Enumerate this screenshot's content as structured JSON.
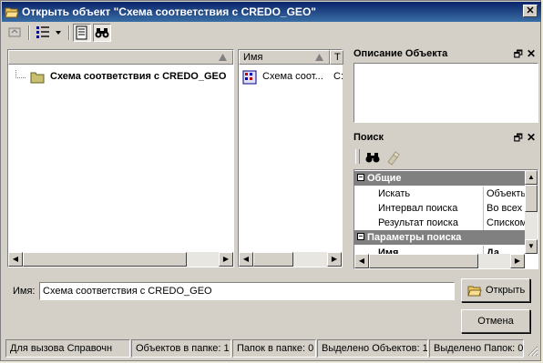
{
  "window": {
    "title": "Открыть объект \"Схема соответствия с CREDO_GEO\"",
    "close_glyph": "✕"
  },
  "tree": {
    "items": [
      {
        "label": "Схема соответствия с CREDO_GEO"
      }
    ]
  },
  "list": {
    "columns": [
      "Имя",
      "Т"
    ],
    "rows": [
      {
        "name": "Схема соот...",
        "type": "С:"
      }
    ]
  },
  "description_panel": {
    "title": "Описание Объекта"
  },
  "search_panel": {
    "title": "Поиск",
    "categories": [
      {
        "name": "Общие",
        "props": [
          {
            "name": "Искать",
            "value": "Объекты"
          },
          {
            "name": "Интервал поиска",
            "value": "Во всех п"
          },
          {
            "name": "Результат поиска",
            "value": "Списком"
          }
        ]
      },
      {
        "name": "Параметры поиска",
        "props": [
          {
            "name": "Имя",
            "value": "Да"
          }
        ]
      }
    ]
  },
  "name_field": {
    "label": "Имя:",
    "value": "Схема соответствия с CREDO_GEO"
  },
  "buttons": {
    "open": "Открыть",
    "cancel": "Отмена"
  },
  "statusbar": [
    "Для вызова Справочн",
    "Объектов в папке: 1",
    "Папок в папке: 0",
    "Выделено Объектов: 1",
    "Выделено Папок: 0"
  ],
  "colors": {
    "title_bar": "#0a246a",
    "window_bg": "#d4d0c8",
    "category_bg": "#808080"
  }
}
